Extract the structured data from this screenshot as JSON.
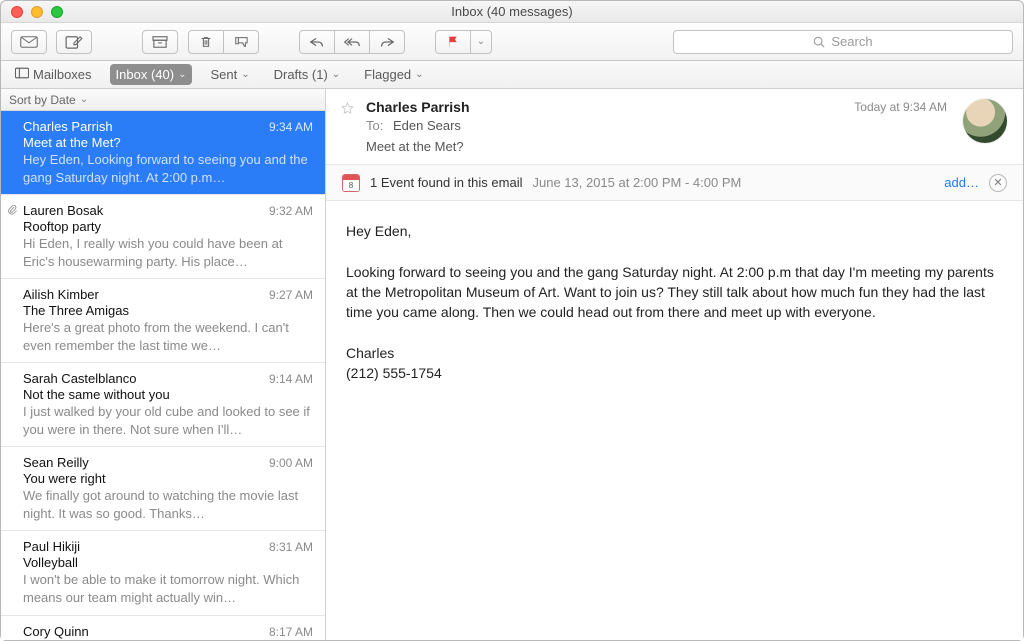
{
  "window": {
    "title": "Inbox (40 messages)"
  },
  "search": {
    "placeholder": "Search"
  },
  "favbar": {
    "mailboxes": "Mailboxes",
    "inbox": "Inbox (40)",
    "sent": "Sent",
    "drafts": "Drafts (1)",
    "flagged": "Flagged"
  },
  "sort": {
    "label": "Sort by Date"
  },
  "messages": [
    {
      "from": "Charles Parrish",
      "time": "9:34 AM",
      "subject": "Meet at the Met?",
      "preview": "Hey Eden, Looking forward to seeing you and the gang Saturday night. At 2:00 p.m…",
      "selected": true
    },
    {
      "from": "Lauren Bosak",
      "time": "9:32 AM",
      "subject": "Rooftop party",
      "preview": "Hi Eden, I really wish you could have been at Eric's housewarming party. His place…",
      "attachment": true
    },
    {
      "from": "Ailish Kimber",
      "time": "9:27 AM",
      "subject": "The Three Amigas",
      "preview": "Here's a great photo from the weekend. I can't even remember the last time we…"
    },
    {
      "from": "Sarah Castelblanco",
      "time": "9:14 AM",
      "subject": "Not the same without you",
      "preview": "I just walked by your old cube and looked to see if you were in there. Not sure when I'll…"
    },
    {
      "from": "Sean Reilly",
      "time": "9:00 AM",
      "subject": "You were right",
      "preview": "We finally got around to watching the movie last night. It was so good. Thanks…"
    },
    {
      "from": "Paul Hikiji",
      "time": "8:31 AM",
      "subject": "Volleyball",
      "preview": "I won't be able to make it tomorrow night. Which means our team might actually win…"
    },
    {
      "from": "Cory Quinn",
      "time": "8:17 AM",
      "subject": "",
      "preview": ""
    }
  ],
  "reader": {
    "sender": "Charles Parrish",
    "date": "Today at 9:34 AM",
    "to_label": "To:",
    "to": "Eden Sears",
    "subject": "Meet at the Met?",
    "event": {
      "day": "8",
      "label": "1 Event found in this email",
      "time": "June 13, 2015 at 2:00 PM - 4:00 PM",
      "add": "add…"
    },
    "body": "Hey Eden,\n\nLooking forward to seeing you and the gang Saturday night. At 2:00 p.m that day I'm meeting my parents at the Metropolitan Museum of Art. Want to join us? They still talk about how much fun they had the last time you came along. Then we could head out from there and meet up with everyone.\n\nCharles\n(212) 555-1754"
  }
}
